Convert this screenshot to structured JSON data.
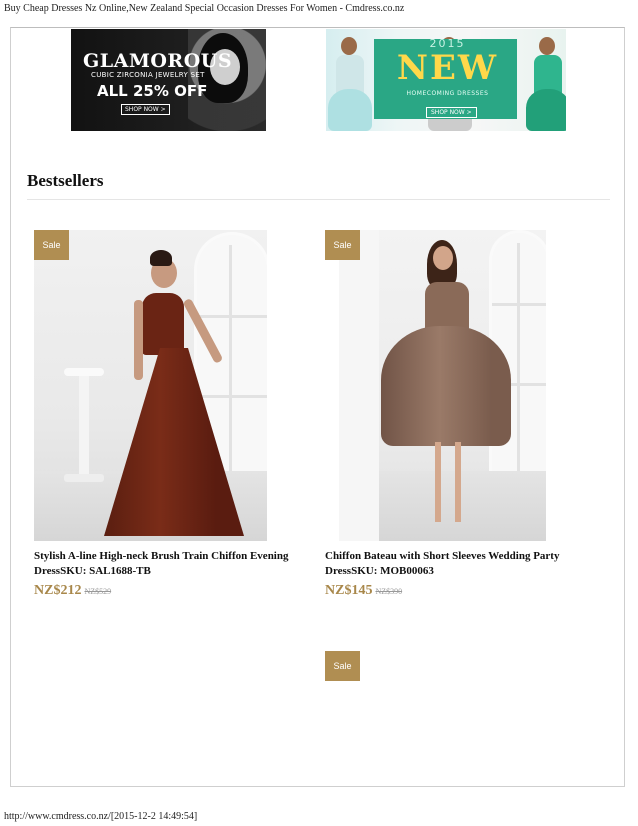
{
  "header": {
    "title": "Buy Cheap Dresses Nz Online,New Zealand Special Occasion Dresses For Women - Cmdress.co.nz"
  },
  "banners": [
    {
      "title": "GLAMOROUS",
      "subtitle": "CUBIC ZIRCONIA JEWELRY SET",
      "offer": "ALL 25% OFF",
      "cta": "SHOP NOW >"
    },
    {
      "year": "2015",
      "title": "NEW",
      "subtitle": "HOMECOMING DRESSES",
      "cta": "SHOP NOW >"
    }
  ],
  "section": {
    "title": "Bestsellers"
  },
  "sale_label": "Sale",
  "products": [
    {
      "name": "Stylish A-line High-neck Brush Train Chiffon Evening DressSKU: SAL1688-TB",
      "price": "NZ$212",
      "old_price": "NZ$529"
    },
    {
      "name": "Chiffon Bateau with Short Sleeves Wedding Party DressSKU: MOB00063",
      "price": "NZ$145",
      "old_price": "NZ$390"
    }
  ],
  "colors": {
    "accent": "#b08e52",
    "price": "#a8874a"
  },
  "footer": {
    "url_stamp": "http://www.cmdress.co.nz/[2015-12-2 14:49:54]"
  }
}
